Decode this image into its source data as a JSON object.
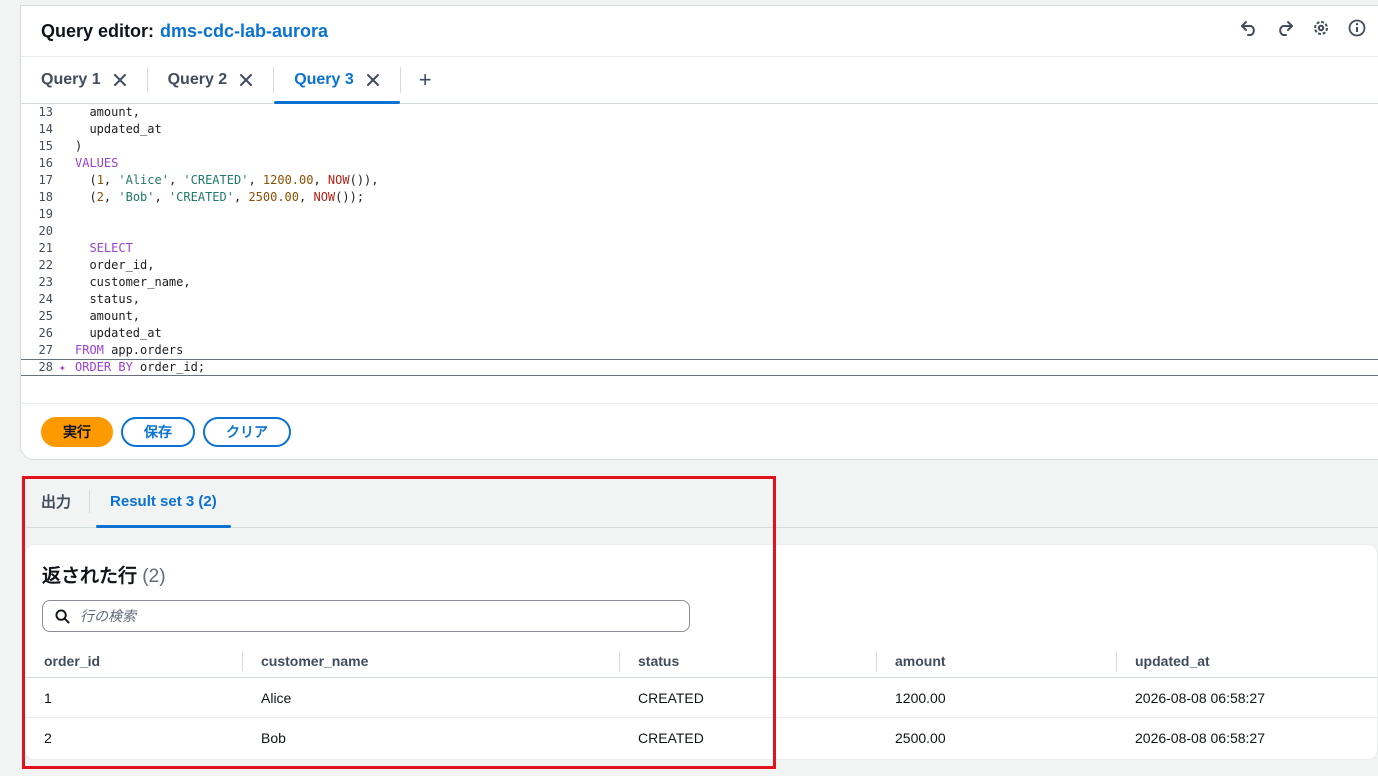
{
  "editor_panel": {
    "title_label": "Query editor:",
    "database_name": "dms-cdc-lab-aurora",
    "header_icons": [
      "undo-icon",
      "redo-icon",
      "settings-icon",
      "info-icon"
    ]
  },
  "query_tabs": [
    {
      "label": "Query 1",
      "active": false
    },
    {
      "label": "Query 2",
      "active": false
    },
    {
      "label": "Query 3",
      "active": true
    }
  ],
  "add_tab_label": "+",
  "code_lines": [
    {
      "num": "13",
      "text": "  amount,"
    },
    {
      "num": "14",
      "text": "  updated_at"
    },
    {
      "num": "15",
      "text": ")"
    },
    {
      "num": "16",
      "text": "VALUES"
    },
    {
      "num": "17",
      "text": "  (1, 'Alice', 'CREATED', 1200.00, NOW()),"
    },
    {
      "num": "18",
      "text": "  (2, 'Bob', 'CREATED', 2500.00, NOW());"
    },
    {
      "num": "19",
      "text": ""
    },
    {
      "num": "20",
      "text": ""
    },
    {
      "num": "21",
      "text": "  SELECT"
    },
    {
      "num": "22",
      "text": "  order_id,"
    },
    {
      "num": "23",
      "text": "  customer_name,"
    },
    {
      "num": "24",
      "text": "  status,"
    },
    {
      "num": "25",
      "text": "  amount,"
    },
    {
      "num": "26",
      "text": "  updated_at"
    },
    {
      "num": "27",
      "text": "FROM app.orders"
    },
    {
      "num": "28",
      "text": "ORDER BY order_id;"
    }
  ],
  "buttons": {
    "run": "実行",
    "save": "保存",
    "clear": "クリア"
  },
  "result_tabs": [
    {
      "label": "出力",
      "active": false
    },
    {
      "label": "Result set 3 (2)",
      "active": true
    }
  ],
  "results": {
    "heading": "返された行",
    "count": "(2)",
    "search_placeholder": "行の検索",
    "columns": [
      "order_id",
      "customer_name",
      "status",
      "amount",
      "updated_at"
    ],
    "rows": [
      [
        "1",
        "Alice",
        "CREATED",
        "1200.00",
        "2026-08-08 06:58:27"
      ],
      [
        "2",
        "Bob",
        "CREATED",
        "2500.00",
        "2026-08-08 06:58:27"
      ]
    ]
  },
  "colors": {
    "accent": "#0972d3",
    "run_button": "#ff9900",
    "highlight_box": "#e2111c"
  }
}
